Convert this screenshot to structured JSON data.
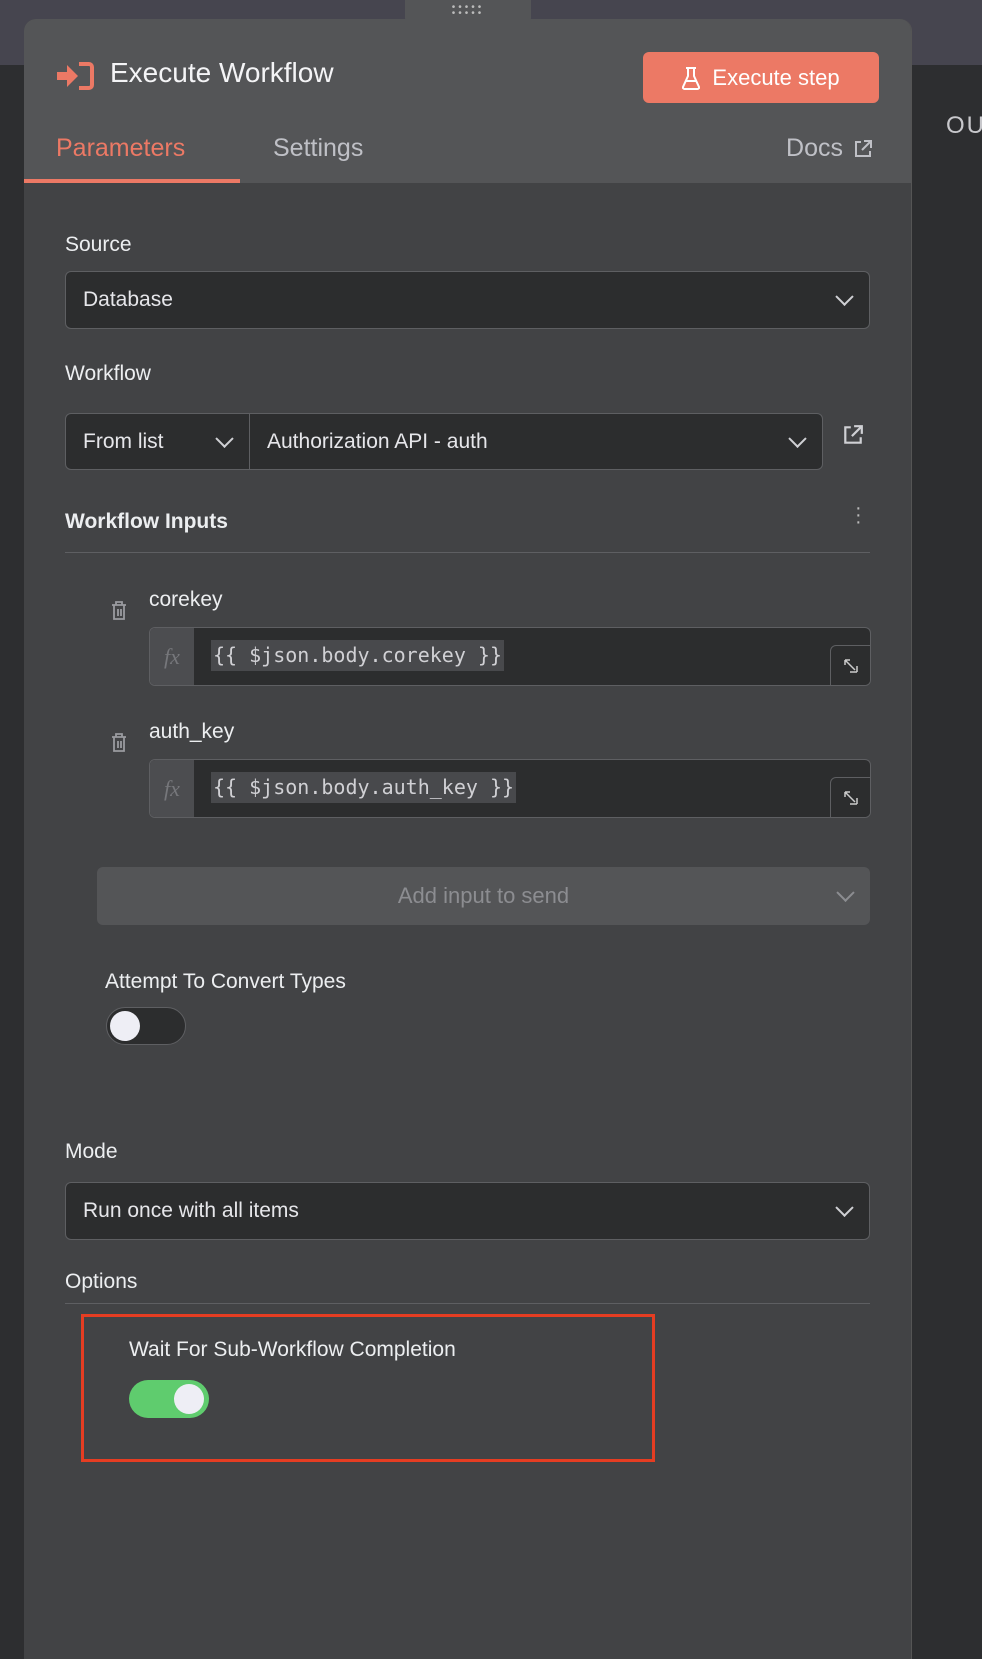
{
  "background": {
    "output_label": "OU"
  },
  "header": {
    "title": "Execute Workflow",
    "execute_button": "Execute step",
    "tabs": [
      {
        "label": "Parameters",
        "active": true
      },
      {
        "label": "Settings",
        "active": false
      }
    ],
    "docs_label": "Docs"
  },
  "colors": {
    "accent": "#ec7965",
    "toggle_on": "#5fcc6e",
    "highlight_box": "#e53d22"
  },
  "params": {
    "source": {
      "label": "Source",
      "value": "Database"
    },
    "workflow": {
      "label": "Workflow",
      "mode": "From list",
      "value": "Authorization API - auth"
    },
    "workflow_inputs": {
      "label": "Workflow Inputs",
      "items": [
        {
          "name": "corekey",
          "value": "{{ $json.body.corekey }}"
        },
        {
          "name": "auth_key",
          "value": "{{ $json.body.auth_key }}"
        }
      ],
      "add_label": "Add input to send"
    },
    "convert_types": {
      "label": "Attempt To Convert Types",
      "enabled": false
    },
    "mode": {
      "label": "Mode",
      "value": "Run once with all items"
    },
    "options": {
      "label": "Options",
      "wait": {
        "label": "Wait For Sub-Workflow Completion",
        "enabled": true
      }
    }
  }
}
